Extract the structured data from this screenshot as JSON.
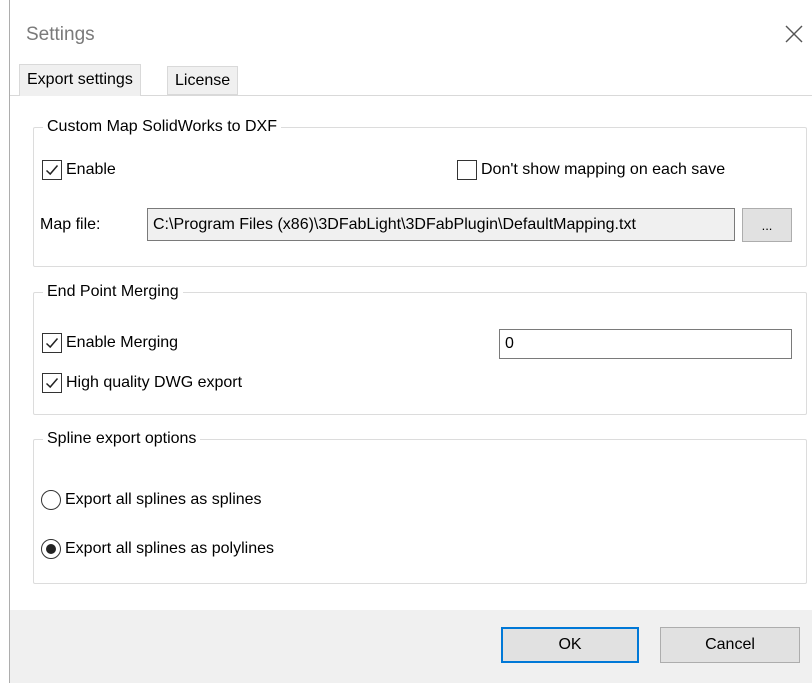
{
  "window": {
    "title": "Settings"
  },
  "tabs": [
    {
      "label": "Export settings",
      "active": true
    },
    {
      "label": "License",
      "active": false
    }
  ],
  "map_group": {
    "legend": "Custom Map SolidWorks to DXF",
    "enable": {
      "label": "Enable",
      "checked": true
    },
    "dont_show": {
      "label": "Don't show mapping on each save",
      "checked": false
    },
    "map_file_label": "Map file:",
    "map_file_value": "C:\\Program Files (x86)\\3DFabLight\\3DFabPlugin\\DefaultMapping.txt",
    "browse_label": "..."
  },
  "merge_group": {
    "legend": "End Point Merging",
    "enable_merging": {
      "label": "Enable Merging",
      "checked": true
    },
    "merge_value": "0",
    "high_quality": {
      "label": "High quality DWG export",
      "checked": true
    }
  },
  "spline_group": {
    "legend": "Spline export options",
    "options": [
      {
        "label": "Export all splines as splines",
        "selected": false
      },
      {
        "label": "Export all splines as polylines",
        "selected": true
      }
    ]
  },
  "footer": {
    "ok_label": "OK",
    "cancel_label": "Cancel"
  },
  "icons": {
    "close": "close-icon",
    "check": "check-icon"
  }
}
